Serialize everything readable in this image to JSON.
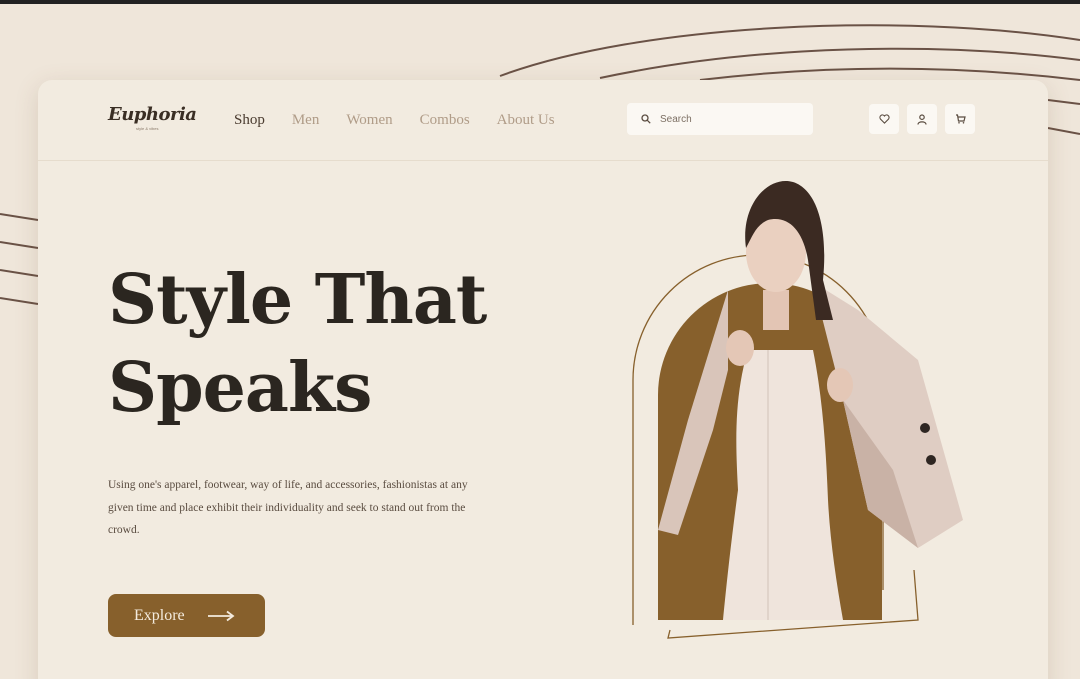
{
  "brand": {
    "logo": "Euphoria",
    "tagline": "style & vibes"
  },
  "nav": {
    "items": [
      {
        "label": "Shop",
        "active": true
      },
      {
        "label": "Men",
        "active": false
      },
      {
        "label": "Women",
        "active": false
      },
      {
        "label": "Combos",
        "active": false
      },
      {
        "label": "About Us",
        "active": false
      }
    ]
  },
  "search": {
    "placeholder": "Search",
    "value": ""
  },
  "header_actions": {
    "icons": [
      "heart-icon",
      "user-icon",
      "cart-icon"
    ]
  },
  "hero": {
    "title_line1": "Style That",
    "title_line2": "Speaks",
    "description": "Using one's apparel, footwear, way of life, and accessories, fashionistas at any given time and place exhibit their individuality and seek to stand out from the crowd.",
    "cta_label": "Explore",
    "cta_icon": "arrow-right-icon",
    "image_icon": "model-photo"
  },
  "colors": {
    "background": "#efe6da",
    "card": "#f2ebe0",
    "accent_brown": "#87602c",
    "text_dark": "#2b2620",
    "nav_muted": "#b09c88"
  }
}
